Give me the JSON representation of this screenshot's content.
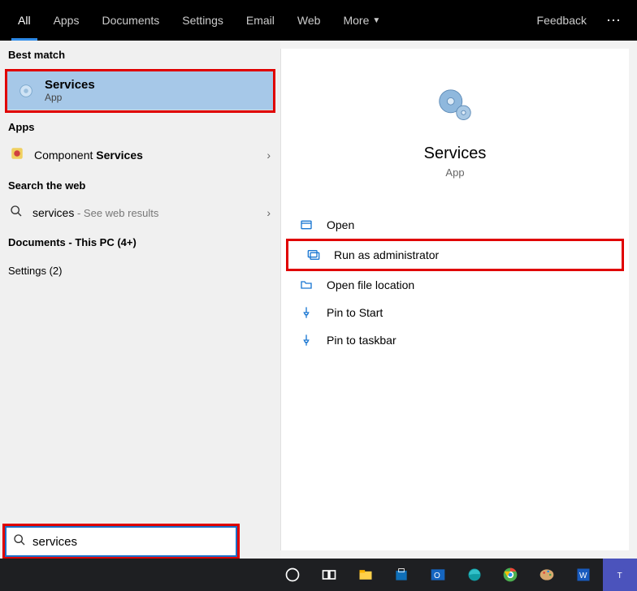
{
  "topnav": {
    "tabs": [
      "All",
      "Apps",
      "Documents",
      "Settings",
      "Email",
      "Web",
      "More"
    ],
    "feedback": "Feedback"
  },
  "left": {
    "best_match_header": "Best match",
    "best_match": {
      "title": "Services",
      "sub": "App"
    },
    "apps_header": "Apps",
    "apps_item_prefix": "Component ",
    "apps_item_bold": "Services",
    "search_web_header": "Search the web",
    "web_item_prefix": "services",
    "web_item_suffix": " - See web results",
    "documents_header": "Documents - This PC (4+)",
    "settings_header": "Settings (2)"
  },
  "detail": {
    "title": "Services",
    "sub": "App",
    "actions": {
      "open": "Open",
      "run_admin": "Run as administrator",
      "open_location": "Open file location",
      "pin_start": "Pin to Start",
      "pin_taskbar": "Pin to taskbar"
    }
  },
  "search": {
    "value": "services"
  }
}
